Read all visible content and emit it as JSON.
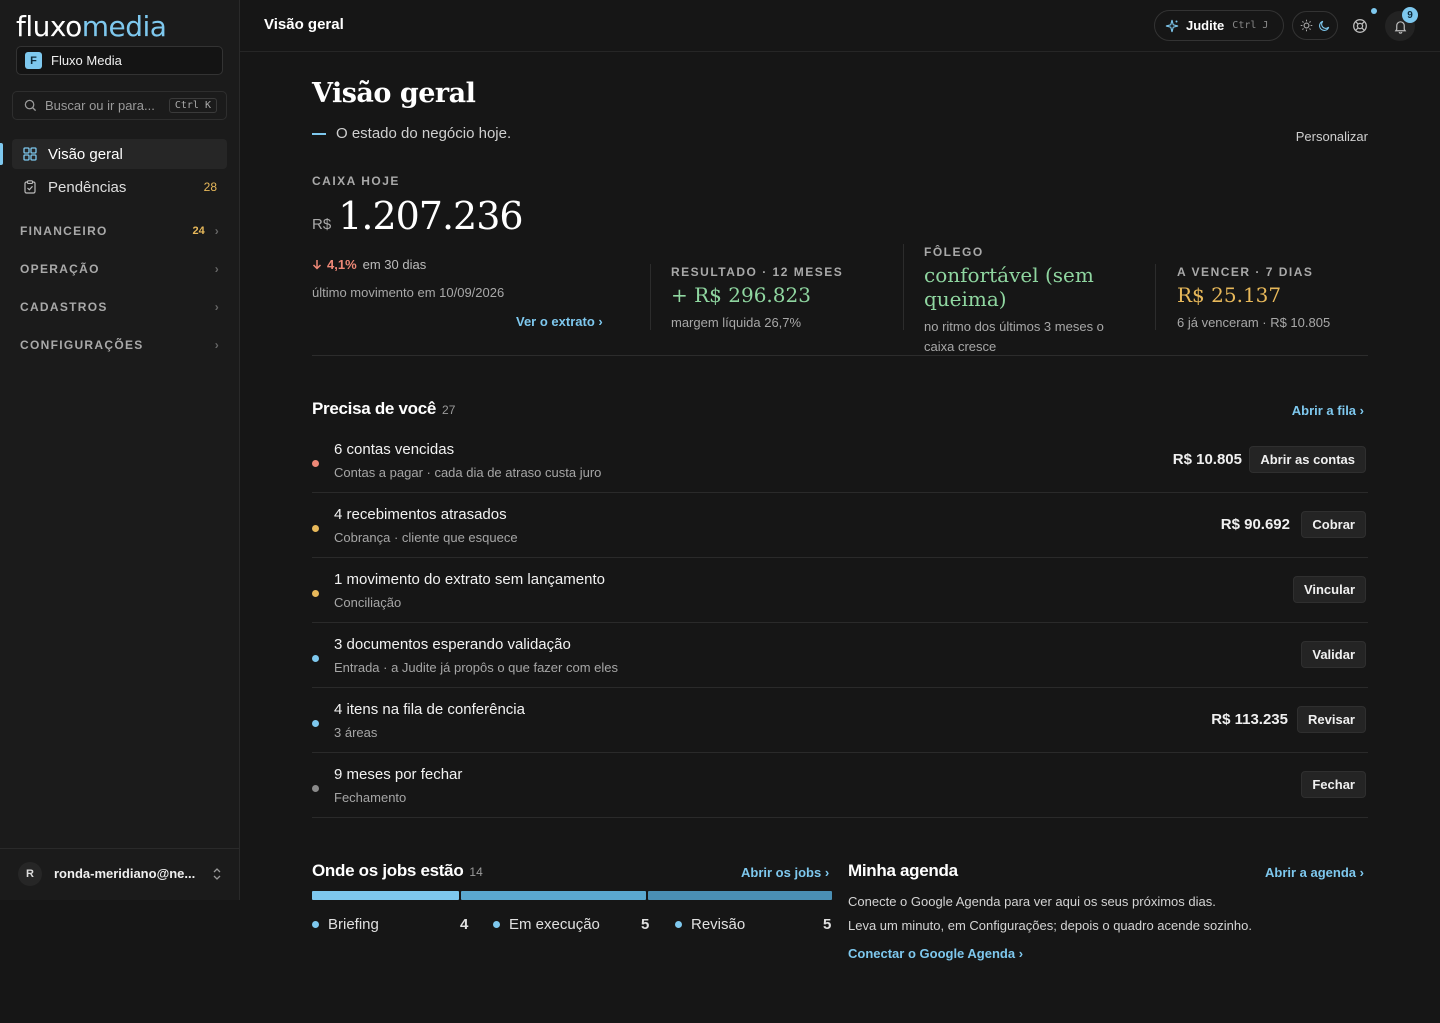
{
  "brand": {
    "logo_a": "fluxo",
    "logo_b": "media",
    "workspace_initial": "F",
    "workspace_name": "Fluxo Media",
    "accent": "#7ec8ee"
  },
  "search": {
    "placeholder": "Buscar ou ir para...",
    "shortcut": "Ctrl K"
  },
  "sidebar": {
    "items": [
      {
        "label": "Visão geral",
        "icon": "grid-icon",
        "active": true
      },
      {
        "label": "Pendências",
        "icon": "clipboard-icon",
        "count": "28"
      }
    ],
    "sections": [
      {
        "label": "FINANCEIRO",
        "count": "24"
      },
      {
        "label": "OPERAÇÃO"
      },
      {
        "label": "CADASTROS"
      },
      {
        "label": "CONFIGURAÇÕES"
      }
    ],
    "user": {
      "initial": "R",
      "name": "ronda-meridiano@ne..."
    }
  },
  "topbar": {
    "title": "Visão geral",
    "assistant": "Judite",
    "assistant_shortcut": "Ctrl J",
    "notifications": "9"
  },
  "page": {
    "title": "Visão geral",
    "subtitle": "O estado do negócio hoje.",
    "customize": "Personalizar"
  },
  "caixa": {
    "label": "CAIXA HOJE",
    "currency": "R$",
    "value": "1.207.236",
    "delta": "4,1%",
    "delta_suffix": "em 30 dias",
    "last_movement": "último movimento em 10/09/2026",
    "link": "Ver o extrato"
  },
  "kpis": [
    {
      "label": "RESULTADO · 12 MESES",
      "value": "+ R$ 296.823",
      "note": "margem líquida 26,7%",
      "color": "#8fd6a0"
    },
    {
      "label": "FÔLEGO",
      "value": "confortável (sem queima)",
      "note": "no ritmo dos últimos 3 meses o caixa cresce",
      "color": "#8fd6a0"
    },
    {
      "label": "A VENCER · 7 DIAS",
      "value": "R$ 25.137",
      "note": "6 já venceram · R$ 10.805",
      "color": "#e7b85a"
    }
  ],
  "needs": {
    "title": "Precisa de você",
    "count": "27",
    "link": "Abrir a fila",
    "rows": [
      {
        "title": "6 contas vencidas",
        "sub": "Contas a pagar · cada dia de atraso custa juro",
        "amount": "R$ 10.805",
        "action": "Abrir as contas",
        "dot": "#ee8877"
      },
      {
        "title": "4 recebimentos atrasados",
        "sub": "Cobrança · cliente que esquece",
        "amount": "R$ 90.692",
        "action": "Cobrar",
        "dot": "#e7b85a"
      },
      {
        "title": "1 movimento do extrato sem lançamento",
        "sub": "Conciliação",
        "amount": "",
        "action": "Vincular",
        "dot": "#e7b85a"
      },
      {
        "title": "3 documentos esperando validação",
        "sub": "Entrada · a Judite já propôs o que fazer com eles",
        "amount": "",
        "action": "Validar",
        "dot": "#7ec8ee"
      },
      {
        "title": "4 itens na fila de conferência",
        "sub": "3 áreas",
        "amount": "R$ 113.235",
        "action": "Revisar",
        "dot": "#7ec8ee"
      },
      {
        "title": "9 meses por fechar",
        "sub": "Fechamento",
        "amount": "",
        "action": "Fechar",
        "dot": "#8a8a8a"
      }
    ]
  },
  "jobs": {
    "title": "Onde os jobs estão",
    "count": "14",
    "link": "Abrir os jobs",
    "stages": [
      {
        "label": "Briefing",
        "value": "4",
        "color": "#7ec8ee"
      },
      {
        "label": "Em execução",
        "value": "5",
        "color": "#5aa8d0"
      },
      {
        "label": "Revisão",
        "value": "5",
        "color": "#4a8fb4"
      }
    ]
  },
  "agenda": {
    "title": "Minha agenda",
    "link": "Abrir a agenda",
    "line1": "Conecte o Google Agenda para ver aqui os seus próximos dias.",
    "line2": "Leva um minuto, em Configurações; depois o quadro acende sozinho.",
    "cta": "Conectar o Google Agenda"
  }
}
